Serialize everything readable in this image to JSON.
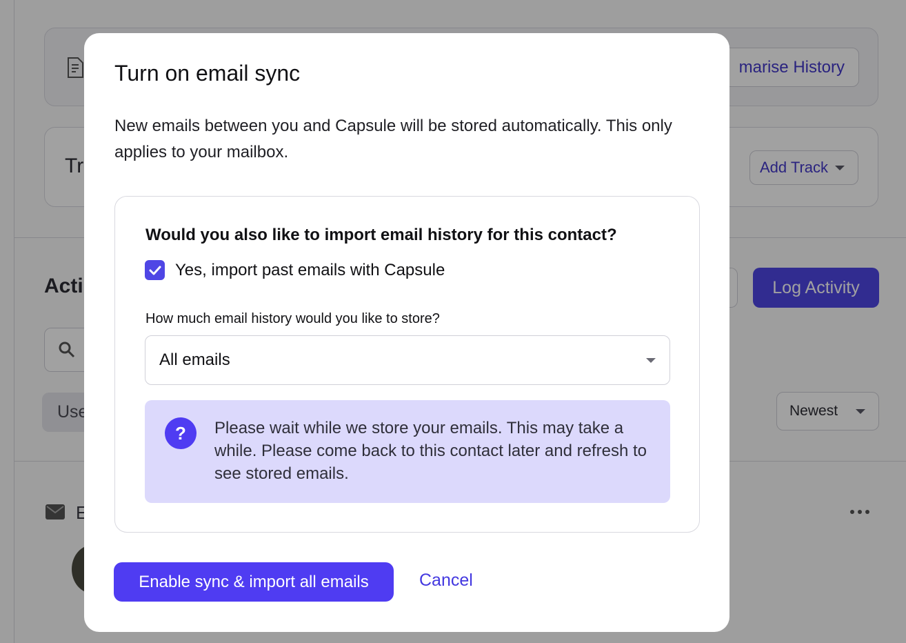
{
  "background": {
    "summarise_history_label": "marise History",
    "tracks_title_partial": "Tr",
    "add_track_label": "Add Track",
    "activity_title_partial": "Acti",
    "log_activity_label": "Log Activity",
    "filter_chip_partial": "Use",
    "sort_select_value": "Newest",
    "entry_partial": "E"
  },
  "modal": {
    "title": "Turn on email sync",
    "description": "New emails between you and Capsule will be stored automatically. This only applies to your mailbox.",
    "import_question": "Would you also like to import email history for this contact?",
    "import_checkbox_label": "Yes, import past emails with Capsule",
    "import_checked": true,
    "history_label": "How much email history would you like to store?",
    "history_select_value": "All emails",
    "info_text": "Please wait while we store your emails. This may take a while. Please come back to this contact later and refresh to see stored emails.",
    "primary_button_label": "Enable sync & import all emails",
    "cancel_label": "Cancel"
  },
  "colors": {
    "accent": "#4f46e5",
    "info_background": "#dcd9fc",
    "link": "#4338e0"
  }
}
